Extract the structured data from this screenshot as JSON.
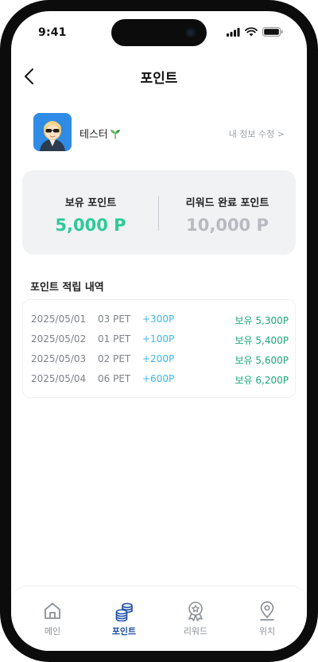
{
  "status_bar": {
    "time": "9:41"
  },
  "header": {
    "title": "포인트"
  },
  "profile": {
    "name": "테스터",
    "edit_link": "내 정보 수정 >"
  },
  "points_summary": {
    "held_label": "보유 포인트",
    "held_value": "5,000 P",
    "reward_label": "리워드 완료 포인트",
    "reward_value": "10,000 P",
    "colors": {
      "held": "#2fc99a",
      "reward": "#b7bbc0"
    }
  },
  "history": {
    "title": "포인트 적립 내역",
    "rows": [
      {
        "date": "2025/05/01",
        "pet": "03 PET",
        "earned": "+300P",
        "balance": "보유 5,300P"
      },
      {
        "date": "2025/05/02",
        "pet": "01 PET",
        "earned": "+100P",
        "balance": "보유 5,400P"
      },
      {
        "date": "2025/05/03",
        "pet": "02 PET",
        "earned": "+200P",
        "balance": "보유 5,600P"
      },
      {
        "date": "2025/05/04",
        "pet": "06 PET",
        "earned": "+600P",
        "balance": "보유 6,200P"
      }
    ]
  },
  "tab_bar": {
    "active": "포인트",
    "tabs": [
      {
        "label": "메인",
        "icon": "home-icon"
      },
      {
        "label": "포인트",
        "icon": "coins-icon"
      },
      {
        "label": "리워드",
        "icon": "badge-icon"
      },
      {
        "label": "위치",
        "icon": "location-pin-icon"
      }
    ],
    "active_color": "#1f4fa6"
  }
}
